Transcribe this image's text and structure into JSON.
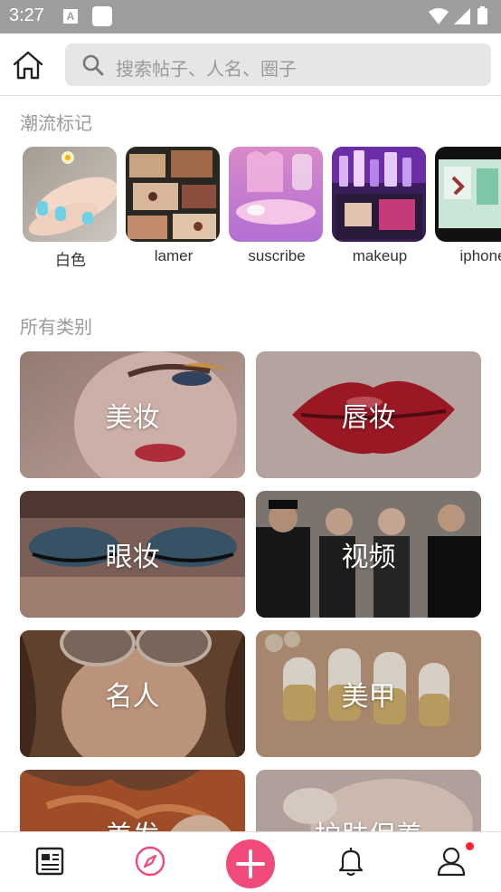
{
  "status_bar": {
    "time": "3:27",
    "a_icon_letter": "A"
  },
  "search": {
    "placeholder": "搜索帖子、人名、圈子"
  },
  "trend_section": {
    "title": "潮流标记",
    "tags": [
      {
        "label": "白色"
      },
      {
        "label": "lamer"
      },
      {
        "label": "suscribe"
      },
      {
        "label": "makeup"
      },
      {
        "label": "iphone"
      }
    ]
  },
  "category_section": {
    "title": "所有类别",
    "categories": [
      {
        "label": "美妆"
      },
      {
        "label": "唇妆"
      },
      {
        "label": "眼妆"
      },
      {
        "label": "视频"
      },
      {
        "label": "名人"
      },
      {
        "label": "美甲"
      },
      {
        "label": "美发"
      },
      {
        "label": "护肤保养"
      }
    ]
  },
  "bottom_nav": {
    "items": [
      "feed-icon",
      "discover-icon",
      "add-icon",
      "bell-icon",
      "profile-icon"
    ],
    "accent_color": "#ef4a7a",
    "notification_dot_color": "#ff1f2e"
  }
}
